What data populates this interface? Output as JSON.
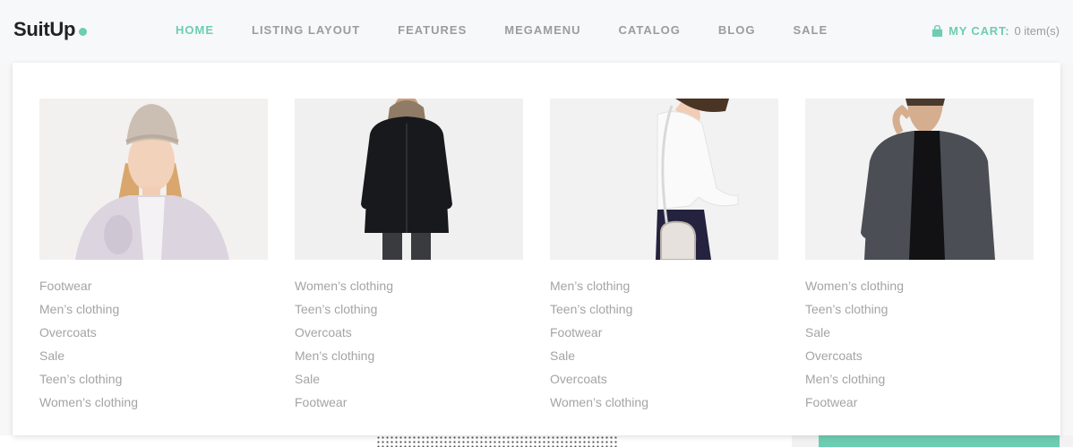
{
  "brand": {
    "name": "SuitUp"
  },
  "nav": {
    "items": [
      {
        "label": "HOME",
        "active": true
      },
      {
        "label": "LISTING LAYOUT",
        "active": false
      },
      {
        "label": "FEATURES",
        "active": false
      },
      {
        "label": "MEGAMENU",
        "active": false
      },
      {
        "label": "CATALOG",
        "active": false
      },
      {
        "label": "BLOG",
        "active": false
      },
      {
        "label": "SALE",
        "active": false
      }
    ]
  },
  "cart": {
    "label": "MY CART:",
    "count": "0 item(s)",
    "icon": "shopping-bag-icon"
  },
  "megamenu": {
    "columns": [
      {
        "image": "woman-beanie-jacket-photo",
        "links": [
          "Footwear",
          "Men’s clothing",
          "Overcoats",
          "Sale",
          "Teen’s clothing",
          "Women’s clothing"
        ]
      },
      {
        "image": "man-black-parka-photo",
        "links": [
          "Women’s clothing",
          "Teen’s clothing",
          "Overcoats",
          "Men’s clothing",
          "Sale",
          "Footwear"
        ]
      },
      {
        "image": "woman-white-top-bag-photo",
        "links": [
          "Men’s clothing",
          "Teen’s clothing",
          "Footwear",
          "Sale",
          "Overcoats",
          "Women’s clothing"
        ]
      },
      {
        "image": "man-grey-cardigan-photo",
        "links": [
          "Women’s clothing",
          "Teen’s clothing",
          "Sale",
          "Overcoats",
          "Men’s clothing",
          "Footwear"
        ]
      }
    ]
  },
  "colors": {
    "accent": "#6dcdb1",
    "nav_text": "#9c9c9c",
    "link_text": "#a4a4a4",
    "logo_text": "#222222"
  }
}
